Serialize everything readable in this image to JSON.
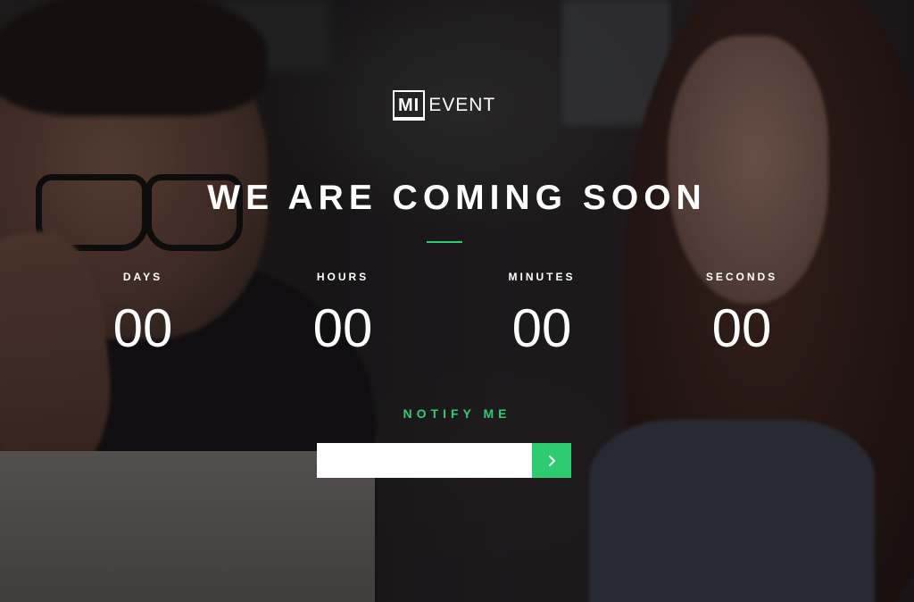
{
  "brand": {
    "box_text": "MI",
    "word": "EVENT"
  },
  "headline": "WE ARE COMING SOON",
  "accent_color": "#2ecc71",
  "countdown": [
    {
      "label": "DAYS",
      "value": "00"
    },
    {
      "label": "HOURS",
      "value": "00"
    },
    {
      "label": "MINUTES",
      "value": "00"
    },
    {
      "label": "SECONDS",
      "value": "00"
    }
  ],
  "notify": {
    "title": "NOTIFY ME",
    "email_value": "",
    "email_placeholder": "",
    "submit_icon": "chevron-right-icon"
  }
}
